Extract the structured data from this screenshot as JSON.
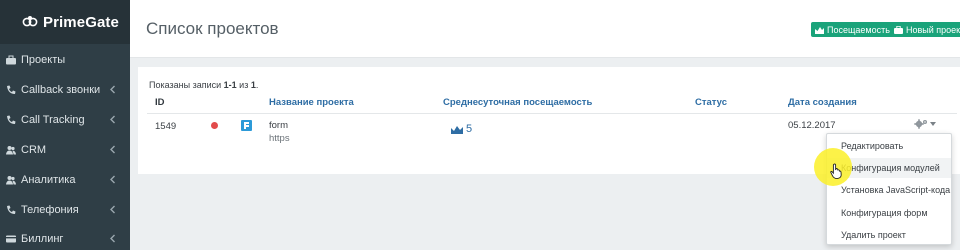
{
  "app": {
    "name": "PrimeGate"
  },
  "sidebar": {
    "items": [
      {
        "label": "Проекты",
        "icon": "briefcase-icon",
        "has_submenu": false
      },
      {
        "label": "Callback звонки",
        "icon": "phone-icon",
        "has_submenu": true
      },
      {
        "label": "Call Tracking",
        "icon": "phone-icon",
        "has_submenu": true
      },
      {
        "label": "CRM",
        "icon": "users-icon",
        "has_submenu": true
      },
      {
        "label": "Аналитика",
        "icon": "users-icon",
        "has_submenu": true
      },
      {
        "label": "Телефония",
        "icon": "phone-icon",
        "has_submenu": true
      },
      {
        "label": "Биллинг",
        "icon": "credit-card-icon",
        "has_submenu": true
      }
    ]
  },
  "header": {
    "title": "Список проектов",
    "attendance_button": "Посещаемость",
    "new_project_button": "Новый проект"
  },
  "table": {
    "info_prefix": "Показаны записи ",
    "info_range": "1-1",
    "info_middle": " из ",
    "info_total": "1",
    "info_suffix": ".",
    "columns": {
      "id": "ID",
      "name": "Название проекта",
      "daily_visits": "Среднесуточная посещаемость",
      "status": "Статус",
      "created": "Дата создания"
    },
    "rows": [
      {
        "id": "1549",
        "name": "form",
        "protocol": "https",
        "daily_visits": "5",
        "created": "05.12.2017",
        "status_color": "#e24b4b"
      }
    ]
  },
  "action_menu": {
    "items": [
      "Редактировать",
      "Конфигурация модулей",
      "Установка JavaScript-кода",
      "Конфигурация форм",
      "Удалить проект"
    ],
    "hovered": "Конфигурация модулей"
  },
  "colors": {
    "sidebar": "#2f3e46",
    "accent_button": "#1aa37a",
    "link": "#2e6da4"
  }
}
